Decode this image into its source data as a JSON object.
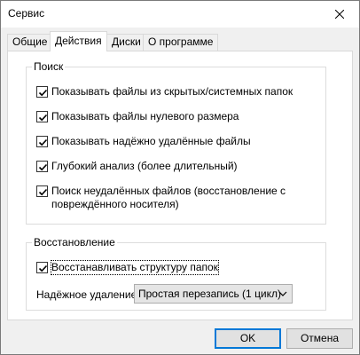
{
  "window": {
    "title": "Сервис",
    "close_icon": "close-icon"
  },
  "tabs": [
    {
      "label": "Общие",
      "active": false
    },
    {
      "label": "Действия",
      "active": true
    },
    {
      "label": "Диски",
      "active": false
    },
    {
      "label": "О программе",
      "active": false
    }
  ],
  "search_group": {
    "title": "Поиск",
    "options": [
      {
        "label": "Показывать файлы из скрытых/системных папок",
        "checked": true
      },
      {
        "label": "Показывать файлы нулевого размера",
        "checked": true
      },
      {
        "label": "Показывать надёжно удалённые файлы",
        "checked": true
      },
      {
        "label": "Глубокий анализ (более длительный)",
        "checked": true
      },
      {
        "label_line1": "Поиск неудалённых файлов (восстановление с",
        "label_line2": "повреждённого носителя)",
        "checked": true
      }
    ]
  },
  "restore_group": {
    "title": "Восстановление",
    "restore_structure": {
      "label": "Восстанавливать структуру папок",
      "checked": true
    },
    "secure_delete": {
      "label": "Надёжное удаление",
      "value": "Простая перезапись (1 цикл)"
    }
  },
  "buttons": {
    "ok": "OK",
    "cancel": "Отмена"
  },
  "colors": {
    "dialog_bg": "#f0f0f0",
    "panel_bg": "#ffffff",
    "default_button_border": "#0078d7"
  }
}
